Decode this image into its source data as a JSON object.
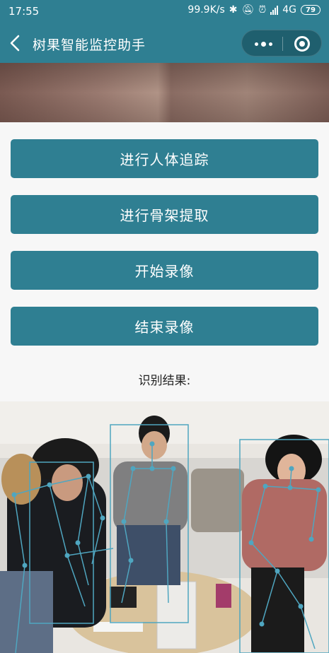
{
  "status_bar": {
    "time": "17:55",
    "speed": "99.9K/s",
    "network": "4G",
    "battery": "79"
  },
  "nav": {
    "title": "树果智能监控助手"
  },
  "buttons": {
    "track": "进行人体追踪",
    "skeleton": "进行骨架提取",
    "start_record": "开始录像",
    "stop_record": "结束录像"
  },
  "result": {
    "label": "识别结果:"
  },
  "colors": {
    "primary": "#2f7f92",
    "capsule": "#1f5f6e",
    "overlay": "#4fa6c0"
  }
}
